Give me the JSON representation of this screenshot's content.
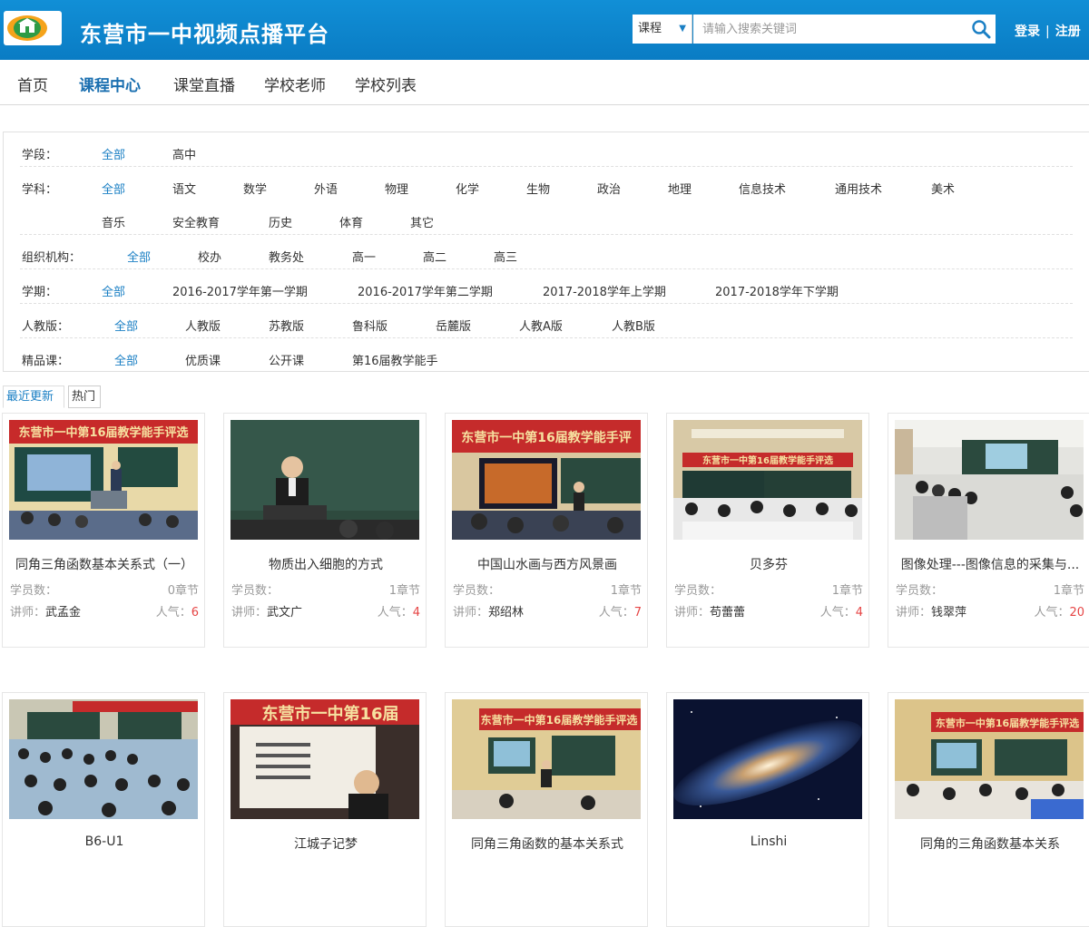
{
  "header": {
    "title": "东营市一中视频点播平台",
    "search_type": "课程",
    "search_placeholder": "请输入搜索关键词",
    "login": "登录",
    "sep": "|",
    "register": "注册"
  },
  "nav": [
    "首页",
    "课程中心",
    "课堂直播",
    "学校老师",
    "学校列表"
  ],
  "filters": {
    "stage": {
      "label": "学段：",
      "options": [
        "全部",
        "高中"
      ]
    },
    "subject": {
      "label": "学科：",
      "options": [
        "全部",
        "语文",
        "数学",
        "外语",
        "物理",
        "化学",
        "生物",
        "政治",
        "地理",
        "信息技术",
        "通用技术",
        "美术",
        "音乐",
        "安全教育",
        "历史",
        "体育",
        "其它"
      ]
    },
    "org": {
      "label": "组织机构：",
      "options": [
        "全部",
        "校办",
        "教务处",
        "高一",
        "高二",
        "高三"
      ]
    },
    "term": {
      "label": "学期：",
      "options": [
        "全部",
        "2016-2017学年第一学期",
        "2016-2017学年第二学期",
        "2017-2018学年上学期",
        "2017-2018学年下学期"
      ]
    },
    "edition": {
      "label": "人教版：",
      "options": [
        "全部",
        "人教版",
        "苏教版",
        "鲁科版",
        "岳麓版",
        "人教A版",
        "人教B版"
      ]
    },
    "quality": {
      "label": "精品课：",
      "options": [
        "全部",
        "优质课",
        "公开课",
        "第16届教学能手"
      ]
    }
  },
  "tabs": [
    "最近更新",
    "热门"
  ],
  "labels": {
    "students": "学员数：",
    "teacher": "讲师：",
    "popularity": "人气："
  },
  "courses": [
    {
      "title": "同角三角函数基本关系式（一）",
      "chapters": "0章节",
      "teacher": "武孟金",
      "popularity": "6"
    },
    {
      "title": "物质出入细胞的方式",
      "chapters": "1章节",
      "teacher": "武文广",
      "popularity": "4"
    },
    {
      "title": "中国山水画与西方风景画",
      "chapters": "1章节",
      "teacher": "郑绍林",
      "popularity": "7"
    },
    {
      "title": "贝多芬",
      "chapters": "1章节",
      "teacher": "苟蕾蕾",
      "popularity": "4"
    },
    {
      "title": "图像处理---图像信息的采集与...",
      "chapters": "1章节",
      "teacher": "钱翠萍",
      "popularity": "20"
    },
    {
      "title": "B6-U1"
    },
    {
      "title": "江城子记梦"
    },
    {
      "title": "同角三角函数的基本关系式"
    },
    {
      "title": "Linshi"
    },
    {
      "title": "同角的三角函数基本关系"
    }
  ],
  "thumb_texts": {
    "t0": "东营市一中第16届教学能手评选",
    "t2": "东营市一中第16届教学能手评",
    "t3": "东营市一中第16届教学能手评选",
    "t6": "东营市一中第16届",
    "t7": "东营市一中第16届教学能手评选",
    "t9": "东营市一中第16届教学能手评选"
  }
}
